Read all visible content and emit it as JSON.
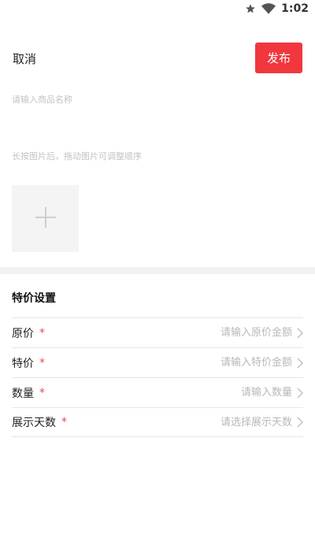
{
  "status_bar": {
    "time": "1:02"
  },
  "header": {
    "cancel_label": "取消",
    "publish_label": "发布",
    "publish_color": "#f0373d"
  },
  "product": {
    "name_placeholder": "请输入商品名称",
    "image_hint": "长按图片后，拖动图片可调整顺序"
  },
  "special_price": {
    "title": "特价设置",
    "rows": [
      {
        "label": "原价",
        "required": "*",
        "placeholder": "请输入原价金额"
      },
      {
        "label": "特价",
        "required": "*",
        "placeholder": "请输入特价金额"
      },
      {
        "label": "数量",
        "required": "*",
        "placeholder": "请输入数量"
      },
      {
        "label": "展示天数",
        "required": "*",
        "placeholder": "请选择展示天数"
      }
    ]
  }
}
